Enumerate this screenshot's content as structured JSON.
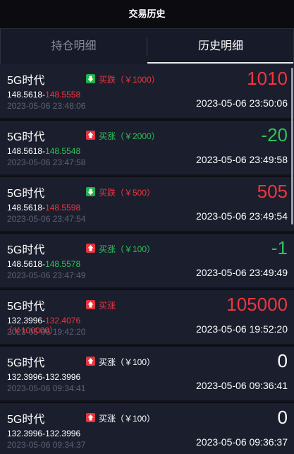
{
  "header": {
    "title": "交易历史"
  },
  "tabs": [
    {
      "label": "持仓明细",
      "active": false
    },
    {
      "label": "历史明细",
      "active": true
    }
  ],
  "colors": {
    "up": "#f0353e",
    "down": "#2ec25b",
    "neutral": "#ffffff"
  },
  "items": [
    {
      "name": "5G时代",
      "icon": "arrow-down-icon",
      "direction": "买跌（￥1000）",
      "direction_color": "red",
      "price_open": "148.5618",
      "price_sep": "-",
      "price_close": "148.5558",
      "close_color": "red",
      "open_time": "2023-05-06 23:48:06",
      "amount": "1010",
      "amount_color": "red",
      "close_time": "2023-05-06 23:50:06"
    },
    {
      "name": "5G时代",
      "icon": "arrow-up-icon",
      "direction": "买涨（￥2000）",
      "direction_color": "green",
      "price_open": "148.5618",
      "price_sep": "-",
      "price_close": "148.5548",
      "close_color": "green",
      "open_time": "2023-05-06 23:47:58",
      "amount": "-20",
      "amount_color": "green",
      "close_time": "2023-05-06 23:49:58"
    },
    {
      "name": "5G时代",
      "icon": "arrow-down-icon",
      "direction": "买跌（￥500）",
      "direction_color": "red",
      "price_open": "148.5618",
      "price_sep": "-",
      "price_close": "148.5598",
      "close_color": "red",
      "open_time": "2023-05-06 23:47:54",
      "amount": "505",
      "amount_color": "red",
      "close_time": "2023-05-06 23:49:54"
    },
    {
      "name": "5G时代",
      "icon": "arrow-up-icon",
      "direction": "买涨（￥100）",
      "direction_color": "green",
      "price_open": "148.5618",
      "price_sep": "-",
      "price_close": "148.5578",
      "close_color": "green",
      "open_time": "2023-05-06 23:47:49",
      "amount": "-1",
      "amount_color": "green",
      "close_time": "2023-05-06 23:49:49"
    },
    {
      "name": "5G时代",
      "icon": "arrow-up-icon",
      "direction": "买涨",
      "direction_color": "red",
      "price_open": "132.3996",
      "price_sep": "-",
      "price_close": "132.4076",
      "close_color": "red",
      "open_time": "2023-05-06 19:42:20",
      "overflow_note": "（￥100000）",
      "amount": "105000",
      "amount_color": "red",
      "close_time": "2023-05-06 19:52:20"
    },
    {
      "name": "5G时代",
      "icon": "arrow-up-icon",
      "direction": "买涨（￥100）",
      "direction_color": "white",
      "price_open": "132.3996",
      "price_sep": "-",
      "price_close": "132.3996",
      "close_color": "white",
      "open_time": "2023-05-06 09:34:41",
      "amount": "0",
      "amount_color": "white",
      "close_time": "2023-05-06 09:36:41"
    },
    {
      "name": "5G时代",
      "icon": "arrow-up-icon",
      "direction": "买涨（￥100）",
      "direction_color": "white",
      "price_open": "132.3996",
      "price_sep": "-",
      "price_close": "132.3996",
      "close_color": "white",
      "open_time": "2023-05-06 09:34:37",
      "amount": "0",
      "amount_color": "white",
      "close_time": "2023-05-06 09:36:37"
    }
  ]
}
